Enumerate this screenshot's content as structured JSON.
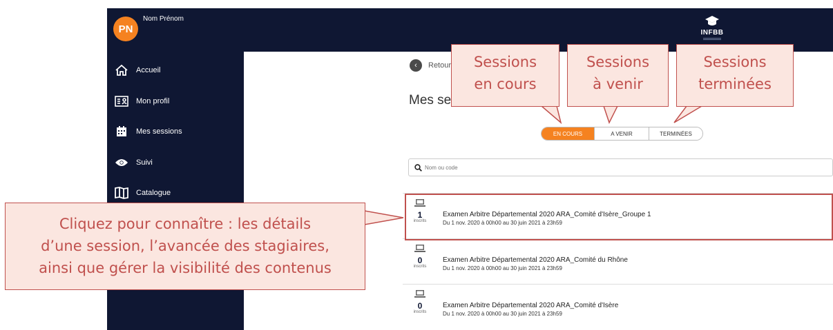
{
  "user": {
    "initials": "PN",
    "name": "Nom Prénom"
  },
  "logo": {
    "text": "INFBB"
  },
  "sidebar": {
    "items": [
      {
        "label": "Accueil",
        "icon": "home-icon"
      },
      {
        "label": "Mon profil",
        "icon": "profile-card-icon"
      },
      {
        "label": "Mes sessions",
        "icon": "calendar-icon"
      },
      {
        "label": "Suivi",
        "icon": "eye-icon"
      },
      {
        "label": "Catalogue",
        "icon": "book-icon"
      }
    ]
  },
  "main": {
    "back_label": "Retour",
    "title": "Mes sessions",
    "tabs": [
      {
        "label": "EN COURS",
        "active": true
      },
      {
        "label": "A VENIR",
        "active": false
      },
      {
        "label": "TERMINÉES",
        "active": false
      }
    ],
    "search": {
      "placeholder": "Nom ou code"
    },
    "sessions": [
      {
        "count": "1",
        "count_label": "inscrits",
        "title": "Examen Arbitre Départemental 2020 ARA_Comité d'Isère_Groupe 1",
        "date": "Du 1 nov. 2020 à 00h00 au 30 juin 2021 à 23h59"
      },
      {
        "count": "0",
        "count_label": "inscrits",
        "title": "Examen Arbitre Départemental 2020 ARA_Comité du Rhône",
        "date": "Du 1 nov. 2020 à 00h00 au 30 juin 2021 à 23h59"
      },
      {
        "count": "0",
        "count_label": "inscrits",
        "title": "Examen Arbitre Départemental 2020 ARA_Comité d'Isère",
        "date": "Du 1 nov. 2020 à 00h00 au 30 juin 2021 à 23h59"
      }
    ]
  },
  "annotations": {
    "callout_en_cours": {
      "line1": "Sessions",
      "line2": "en cours"
    },
    "callout_a_venir": {
      "line1": "Sessions",
      "line2": "à venir"
    },
    "callout_terminees": {
      "line1": "Sessions",
      "line2": "terminées"
    },
    "callout_click": {
      "line1": "Cliquez pour connaître : les détails",
      "line2": "d’une session, l’avancée des stagiaires,",
      "line3": "ainsi que gérer la visibilité des contenus"
    }
  },
  "colors": {
    "navy": "#0f1733",
    "orange": "#f58220",
    "callout_border": "#c0504d",
    "callout_fill": "#fbe6e0"
  }
}
